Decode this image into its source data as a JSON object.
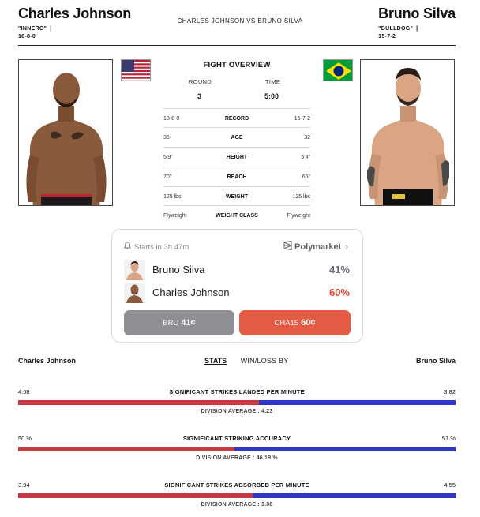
{
  "header": {
    "left_name": "Charles Johnson",
    "left_nickname": "\"INNERG\"",
    "left_record": "18-8-0",
    "matchup": "CHARLES JOHNSON VS BRUNO SILVA",
    "right_name": "Bruno Silva",
    "right_nickname": "\"BULLDOG\"",
    "right_record": "15-7-2",
    "separator": "|"
  },
  "overview": {
    "title": "FIGHT OVERVIEW",
    "round_label": "ROUND",
    "round_value": "3",
    "time_label": "TIME",
    "time_value": "5:00",
    "rows": [
      {
        "left": "18-8-0",
        "label": "RECORD",
        "right": "15-7-2"
      },
      {
        "left": "35",
        "label": "AGE",
        "right": "32"
      },
      {
        "left": "5'9\"",
        "label": "HEIGHT",
        "right": "5'4\""
      },
      {
        "left": "70\"",
        "label": "REACH",
        "right": "65\""
      },
      {
        "left": "125 lbs",
        "label": "WEIGHT",
        "right": "125 lbs"
      },
      {
        "left": "Flyweight",
        "label": "WEIGHT CLASS",
        "right": "Flyweight"
      }
    ]
  },
  "market": {
    "starts_in": "Starts in 3h 47m",
    "provider": "Polymarket",
    "provider_chevron": "›",
    "rows": [
      {
        "name": "Bruno Silva",
        "pct": "41%",
        "pct_color": "#6b6b78"
      },
      {
        "name": "Charles Johnson",
        "pct": "60%",
        "pct_color": "#d9462f"
      }
    ],
    "buttons": {
      "bru_label": "BRU",
      "bru_price": "41¢",
      "cha_label": "CHA15",
      "cha_price": "60¢"
    }
  },
  "stats": {
    "left_name": "Charles Johnson",
    "right_name": "Bruno Silva",
    "tab_stats": "STATS",
    "tab_winloss": "WIN/LOSS BY",
    "metrics": [
      {
        "title": "SIGNIFICANT STRIKES LANDED PER MINUTE",
        "left": "4.68",
        "right": "3.82",
        "left_share": 0.55,
        "average": "DIVISION AVERAGE : 4.23"
      },
      {
        "title": "SIGNIFICANT STRIKING ACCURACY",
        "left": "50 %",
        "right": "51 %",
        "left_share": 0.495,
        "average": "DIVISION AVERAGE : 46.19 %"
      },
      {
        "title": "SIGNIFICANT STRIKES ABSORBED PER MINUTE",
        "left": "3.94",
        "right": "4.55",
        "left_share": 0.537,
        "average": "DIVISION AVERAGE : 3.88"
      }
    ]
  },
  "colors": {
    "red_bar": "#c5383f",
    "blue_bar": "#2f37c8",
    "accent_orange": "#e45b43",
    "button_gray": "#8f8e93"
  },
  "icons": {
    "bell": "bell-icon",
    "polymarket": "polymarket-icon",
    "us_flag": "us-flag-icon",
    "brazil_flag": "brazil-flag-icon"
  }
}
